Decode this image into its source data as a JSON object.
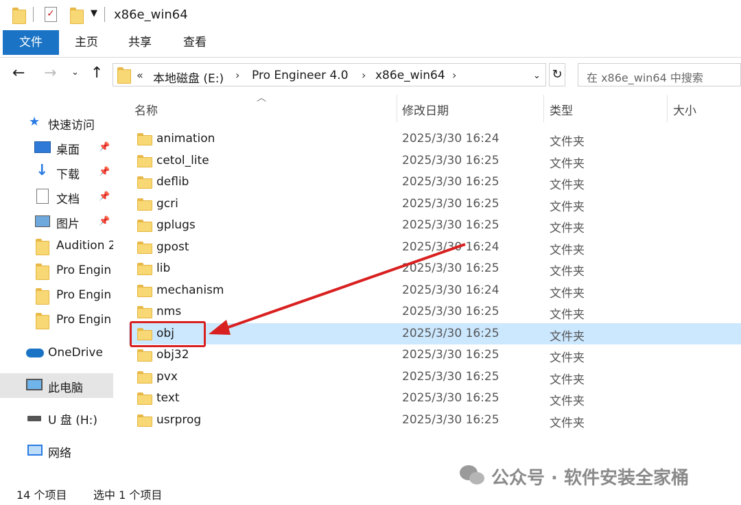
{
  "window": {
    "title": "x86e_win64"
  },
  "ribbon": {
    "tabs": [
      "文件",
      "主页",
      "共享",
      "查看"
    ]
  },
  "address": {
    "overflow": "«",
    "crumbs": [
      "本地磁盘 (E:)",
      "Pro Engineer 4.0",
      "x86e_win64"
    ],
    "search_placeholder": "在 x86e_win64 中搜索"
  },
  "nav": {
    "quick_access": "快速访问",
    "pinned": [
      "桌面",
      "下载",
      "文档",
      "图片"
    ],
    "recent": [
      "Audition 2",
      "Pro Engin",
      "Pro Engin",
      "Pro Engin"
    ],
    "onedrive": "OneDrive",
    "this_pc": "此电脑",
    "usb": "U 盘 (H:)",
    "network": "网络"
  },
  "columns": {
    "name": "名称",
    "modified": "修改日期",
    "type": "类型",
    "size": "大小"
  },
  "files": [
    {
      "name": "animation",
      "modified": "2025/3/30 16:24",
      "type": "文件夹"
    },
    {
      "name": "cetol_lite",
      "modified": "2025/3/30 16:25",
      "type": "文件夹"
    },
    {
      "name": "deflib",
      "modified": "2025/3/30 16:25",
      "type": "文件夹"
    },
    {
      "name": "gcri",
      "modified": "2025/3/30 16:25",
      "type": "文件夹"
    },
    {
      "name": "gplugs",
      "modified": "2025/3/30 16:25",
      "type": "文件夹"
    },
    {
      "name": "gpost",
      "modified": "2025/3/30 16:24",
      "type": "文件夹"
    },
    {
      "name": "lib",
      "modified": "2025/3/30 16:25",
      "type": "文件夹"
    },
    {
      "name": "mechanism",
      "modified": "2025/3/30 16:24",
      "type": "文件夹"
    },
    {
      "name": "nms",
      "modified": "2025/3/30 16:25",
      "type": "文件夹"
    },
    {
      "name": "obj",
      "modified": "2025/3/30 16:25",
      "type": "文件夹"
    },
    {
      "name": "obj32",
      "modified": "2025/3/30 16:25",
      "type": "文件夹"
    },
    {
      "name": "pvx",
      "modified": "2025/3/30 16:25",
      "type": "文件夹"
    },
    {
      "name": "text",
      "modified": "2025/3/30 16:25",
      "type": "文件夹"
    },
    {
      "name": "usrprog",
      "modified": "2025/3/30 16:25",
      "type": "文件夹"
    }
  ],
  "selected_index": 9,
  "status": {
    "count": "14 个项目",
    "selected": "选中 1 个项目"
  },
  "watermark": "公众号 · 软件安装全家桶",
  "colors": {
    "accent": "#1a73c4",
    "selection": "#cce8ff",
    "annotation": "#d92020"
  }
}
